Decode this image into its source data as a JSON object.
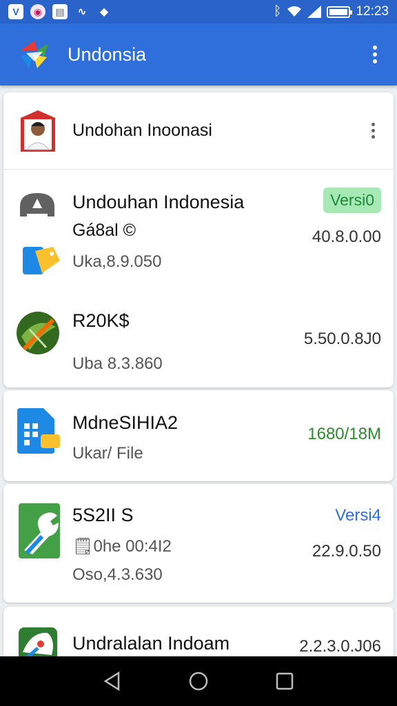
{
  "status_bar": {
    "time": "12:23",
    "left_icons": [
      "vpn-icon",
      "browser-icon",
      "news-icon",
      "mixer-icon",
      "shield-icon"
    ],
    "right_icons": [
      "bluetooth-icon",
      "wifi-icon",
      "signal-icon",
      "battery-icon"
    ]
  },
  "app_bar": {
    "title": "Undonsia",
    "logo_icon": "app-logo-icon",
    "menu_icon": "more-vert-icon"
  },
  "header_card": {
    "title": "Undohan Inoonasi",
    "avatar_icon": "profile-avatar-icon",
    "menu_icon": "more-vert-icon"
  },
  "items": [
    {
      "title": "Undouhan Indonesia",
      "title2": "Gá8al ©",
      "sub": "Uka,8.9.050",
      "badge": "Versi0",
      "right": "40.8.0.00",
      "icon": "cloud-upload-icon",
      "icon2": "folder-tag-icon"
    },
    {
      "title": "R20K$",
      "sub": "Uba 8.3.860",
      "right": "5.50.0.8J0",
      "icon": "nature-leaf-icon"
    },
    {
      "title": "MdneSIHIA2",
      "sub": "Ukar/ File",
      "right": "1680/18M",
      "icon": "file-grid-icon"
    },
    {
      "title": "5S2II S",
      "title2": "🗒0he 00:4I2",
      "sub": "Oso,4.3.630",
      "badge": "Versi4",
      "right": "22.9.0.50",
      "icon": "wrench-icon"
    },
    {
      "title": "Undralalan Indoam",
      "right": "2.2.3.0.J06",
      "icon": "mascot-icon"
    }
  ],
  "nav": {
    "back": "back-icon",
    "home": "home-icon",
    "recents": "recents-icon"
  },
  "colors": {
    "primary": "#2f6fdb",
    "status": "#2a63c9",
    "badge_bg": "#a7e9b4",
    "badge_fg": "#1c8a3a",
    "accent_green": "#2e8b2e"
  }
}
